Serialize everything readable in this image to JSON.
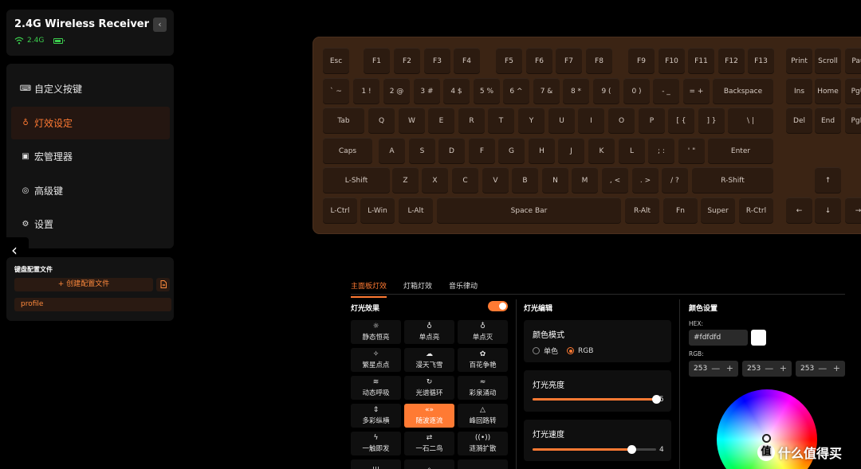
{
  "device": {
    "name": "2.4G Wireless Receiver",
    "mode": "2.4G",
    "collapse": "‹"
  },
  "menu": [
    {
      "label": "自定义按键",
      "icon": "keyboard-icon"
    },
    {
      "label": "灯效设定",
      "icon": "bulb-icon",
      "active": true
    },
    {
      "label": "宏管理器",
      "icon": "macro-icon"
    },
    {
      "label": "高级键",
      "icon": "advanced-key-icon"
    },
    {
      "label": "设置",
      "icon": "gear-icon"
    }
  ],
  "sidebar_toggle": "‹",
  "profiles": {
    "title": "键盘配置文件",
    "create_label": "+ 创建配置文件",
    "items": [
      "profile"
    ]
  },
  "keyboard": {
    "colors": {
      "case": "#3b2414",
      "key": "#2c1b10",
      "legend": "#d6cbc3"
    },
    "rows": [
      [
        "Esc",
        "F1",
        "F2",
        "F3",
        "F4",
        "F5",
        "F6",
        "F7",
        "F8",
        "F9",
        "F10",
        "F11",
        "F12",
        "F13",
        "Print",
        "Scroll",
        "Pau"
      ],
      [
        "` ~",
        "1 !",
        "2 @",
        "3 #",
        "4 $",
        "5 %",
        "6 ^",
        "7 &",
        "8 *",
        "9 (",
        "0 )",
        "- _",
        "= +",
        "Backspace",
        "Ins",
        "Home",
        "PgU"
      ],
      [
        "Tab",
        "Q",
        "W",
        "E",
        "R",
        "T",
        "Y",
        "U",
        "I",
        "O",
        "P",
        "[ {",
        "] }",
        "\\ |",
        "Del",
        "End",
        "PgD"
      ],
      [
        "Caps",
        "A",
        "S",
        "D",
        "F",
        "G",
        "H",
        "J",
        "K",
        "L",
        ";  :",
        "' \"",
        "Enter"
      ],
      [
        "L-Shift",
        "Z",
        "X",
        "C",
        "V",
        "B",
        "N",
        "M",
        ", <",
        ". >",
        "/ ?",
        "R-Shift",
        "↑"
      ],
      [
        "L-Ctrl",
        "L-Win",
        "L-Alt",
        "Space Bar",
        "R-Alt",
        "Fn",
        "Super",
        "R-Ctrl",
        "←",
        "↓",
        "→"
      ]
    ]
  },
  "tabs": [
    {
      "label": "主面板灯效",
      "active": true
    },
    {
      "label": "灯箱灯效"
    },
    {
      "label": "音乐律动"
    }
  ],
  "effects": {
    "title": "灯光效果",
    "enabled": true,
    "items": [
      {
        "label": "静态恒亮",
        "icon": "sun-icon",
        "glyph": "☼"
      },
      {
        "label": "单点亮",
        "icon": "bulb-icon",
        "glyph": "♁"
      },
      {
        "label": "单点灭",
        "icon": "bulb-off-icon",
        "glyph": "♁"
      },
      {
        "label": "繁星点点",
        "icon": "sparkle-icon",
        "glyph": "✧"
      },
      {
        "label": "漫天飞雪",
        "icon": "snow-cloud-icon",
        "glyph": "☁"
      },
      {
        "label": "百花争艳",
        "icon": "flower-icon",
        "glyph": "✿"
      },
      {
        "label": "动态呼吸",
        "icon": "wind-icon",
        "glyph": "≋"
      },
      {
        "label": "光谱循环",
        "icon": "cycle-icon",
        "glyph": "↻"
      },
      {
        "label": "彩泉涌动",
        "icon": "wave-icon",
        "glyph": "≈"
      },
      {
        "label": "多彩纵横",
        "icon": "vertical-arrows-icon",
        "glyph": "⇕"
      },
      {
        "label": "随波逐流",
        "icon": "double-arrow-icon",
        "glyph": "«»",
        "active": true
      },
      {
        "label": "峰回路转",
        "icon": "triangle-icon",
        "glyph": "△"
      },
      {
        "label": "一触即发",
        "icon": "lightning-icon",
        "glyph": "ϟ"
      },
      {
        "label": "一石二鸟",
        "icon": "swap-icon",
        "glyph": "⇄"
      },
      {
        "label": "涟漪扩散",
        "icon": "ripple-icon",
        "glyph": "((•))"
      },
      {
        "label": "",
        "icon": "bars-icon",
        "glyph": "|||"
      },
      {
        "label": "",
        "icon": "diamond-icon",
        "glyph": "◇"
      },
      {
        "label": "",
        "icon": "cloud-icon",
        "glyph": "☁"
      }
    ]
  },
  "light_edit": {
    "title": "灯光编辑",
    "color_mode": {
      "label": "颜色模式",
      "options": [
        "单色",
        "RGB"
      ],
      "selected": "RGB"
    },
    "brightness": {
      "label": "灯光亮度",
      "value": 5,
      "max": 5
    },
    "speed": {
      "label": "灯光速度",
      "value": 4,
      "max": 5
    }
  },
  "color_settings": {
    "title": "颜色设置",
    "hex_label": "HEX:",
    "hex_value": "#fdfdfd",
    "rgb_label": "RGB:",
    "rgb": [
      253,
      253,
      253
    ],
    "pm": "— +"
  },
  "watermark": {
    "logo": "值",
    "text": "什么值得买"
  }
}
